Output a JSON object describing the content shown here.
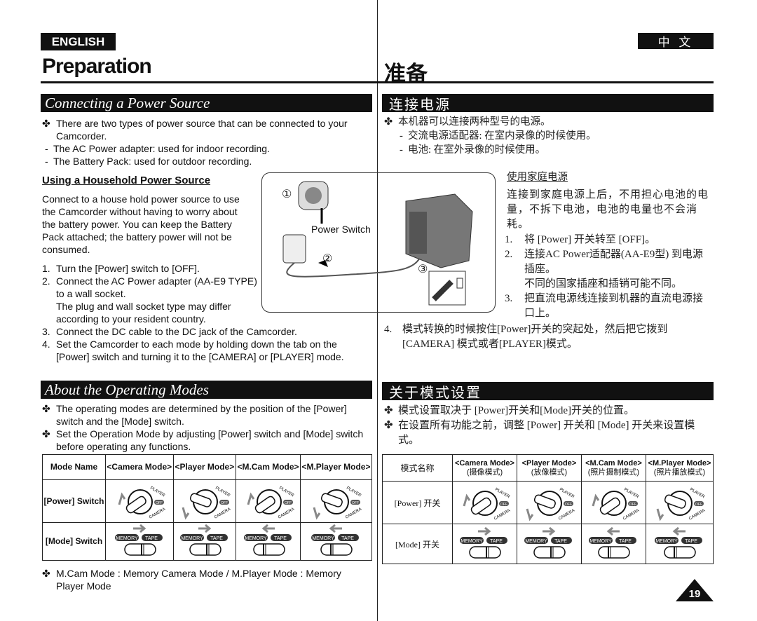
{
  "header": {
    "lang_en": "ENGLISH",
    "lang_zh": "中 文",
    "title_en": "Preparation",
    "title_zh": "准备"
  },
  "sec1": {
    "title_en": "Connecting a Power Source",
    "title_zh": "连接电源",
    "en_bullet": "There are two types of power source that can be connected to your Camcorder.",
    "en_dash": [
      "The AC Power adapter: used for indoor recording.",
      "The Battery Pack: used for outdoor recording."
    ],
    "zh_bullet": "本机器可以连接两种型号的电源。",
    "zh_dash": [
      "交流电源适配器: 在室内录像的时候使用。",
      "电池: 在室外录像的时候使用。"
    ],
    "sub_en": "Using a Household Power Source",
    "intro_en": "Connect to a house hold power source to use the Camcorder without having to worry about the battery power. You can keep the Battery Pack attached; the battery power will not be consumed.",
    "steps_en": [
      "Turn the [Power] switch to [OFF].",
      "Connect the AC Power adapter (AA-E9 TYPE) to a wall socket.",
      "Connect the DC cable to the DC jack of the Camcorder.",
      "Set the Camcorder to each mode by holding down the tab on the [Power] switch and turning it to the [CAMERA] or [PLAYER] mode."
    ],
    "step2_note_en": "The plug and wall socket type may differ according to your resident country.",
    "power_switch_label": "Power Switch",
    "callouts": [
      "①",
      "②",
      "③"
    ],
    "sub_zh": "使用家庭电源",
    "intro_zh": "连接到家庭电源上后，不用担心电池的电量，不拆下电池，电池的电量也不会消耗。",
    "steps_zh": [
      "将 [Power] 开关转至 [OFF]。",
      "连接AC Power适配器(AA-E9型) 到电源插座。",
      "把直流电源线连接到机器的直流电源接口上。",
      "模式转换的时候按住[Power]开关的突起处，然后把它拨到 [CAMERA] 模式或者[PLAYER]模式。"
    ],
    "step2_note_zh": "不同的国家插座和插销可能不同。"
  },
  "sec2": {
    "title_en": "About the Operating Modes",
    "title_zh": "关于模式设置",
    "en_bullets": [
      "The operating modes are determined by the position of the [Power] switch and the [Mode] switch.",
      "Set the Operation Mode by adjusting [Power] switch and [Mode] switch before operating any functions."
    ],
    "zh_bullets": [
      "模式设置取决于 [Power]开关和[Mode]开关的位置。",
      "在设置所有功能之前，调整 [Power] 开关和 [Mode] 开关来设置模式。"
    ],
    "table_en": {
      "row_headers": [
        "Mode Name",
        "[Power] Switch",
        "[Mode] Switch"
      ],
      "cols": [
        "<Camera Mode>",
        "<Player Mode>",
        "<M.Cam Mode>",
        "<M.Player Mode>"
      ]
    },
    "table_zh": {
      "row_headers": [
        "模式名称",
        "[Power] 开关",
        "[Mode] 开关"
      ],
      "cols": [
        "<Camera Mode>",
        "<Player Mode>",
        "<M.Cam Mode>",
        "<M.Player Mode>"
      ],
      "cols_zh": [
        "(摄像模式)",
        "(放像模式)",
        "(照片摄制模式)",
        "(照片播放模式)"
      ]
    },
    "switch_labels": {
      "player": "PLAYER",
      "off": "OFF",
      "camera": "CAMERA",
      "memory": "MEMORY",
      "tape": "TAPE"
    },
    "dial_positions": [
      "camera",
      "player",
      "camera",
      "player"
    ],
    "mode_positions": [
      "tape",
      "tape",
      "memory",
      "memory"
    ],
    "note_en": "M.Cam Mode : Memory Camera Mode / M.Player Mode : Memory Player Mode"
  },
  "page_number": "19"
}
